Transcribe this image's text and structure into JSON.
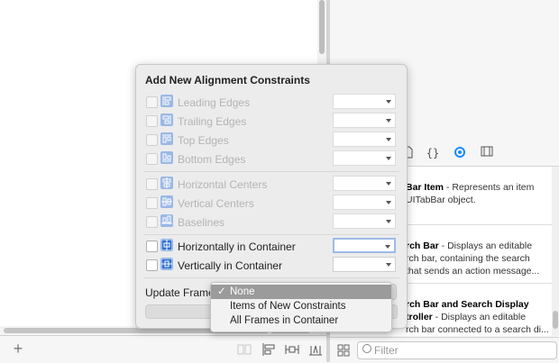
{
  "popover": {
    "title": "Add New Alignment Constraints",
    "rows": [
      {
        "label": "Leading Edges",
        "enabled": false,
        "icon": "leading-edges-icon"
      },
      {
        "label": "Trailing Edges",
        "enabled": false,
        "icon": "trailing-edges-icon"
      },
      {
        "label": "Top Edges",
        "enabled": false,
        "icon": "top-edges-icon"
      },
      {
        "label": "Bottom Edges",
        "enabled": false,
        "icon": "bottom-edges-icon"
      },
      {
        "label": "Horizontal Centers",
        "enabled": false,
        "icon": "horizontal-centers-icon"
      },
      {
        "label": "Vertical Centers",
        "enabled": false,
        "icon": "vertical-centers-icon"
      },
      {
        "label": "Baselines",
        "enabled": false,
        "icon": "baselines-icon"
      },
      {
        "label": "Horizontally in Container",
        "enabled": true,
        "icon": "horizontally-in-container-icon"
      },
      {
        "label": "Vertically in Container",
        "enabled": true,
        "icon": "vertically-in-container-icon"
      }
    ],
    "update_frames_label": "Update Frames",
    "update_frames_menu": {
      "options": [
        "None",
        "Items of New Constraints",
        "All Frames in Container"
      ],
      "selected": "None",
      "check_mark": "✓"
    }
  },
  "library": {
    "items": [
      {
        "title": "Bar Item",
        "desc1": " - Represents an item",
        "desc2": "UITabBar object.",
        "desc3": ""
      },
      {
        "title": "rch Bar",
        "desc1": " - Displays an editable",
        "desc2": "rch bar, containing the search",
        "desc3": "that sends an action message..."
      },
      {
        "title": "rch Bar and Search Display",
        "desc1": "",
        "desc2": "troller - Displays an editable",
        "desc3": "rch bar connected to a search di..."
      }
    ],
    "filter_placeholder": "Filter"
  },
  "colors": {
    "accent": "#1a8cff",
    "constraint_icon": "#2f6fd1",
    "menu_selection": "#9b9b9b"
  }
}
